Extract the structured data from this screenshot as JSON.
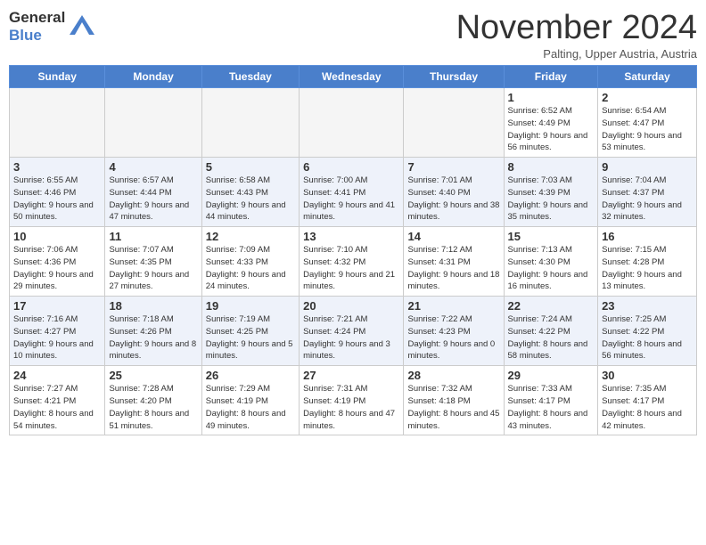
{
  "header": {
    "logo_text1": "General",
    "logo_text2": "Blue",
    "month_title": "November 2024",
    "location": "Palting, Upper Austria, Austria"
  },
  "days_of_week": [
    "Sunday",
    "Monday",
    "Tuesday",
    "Wednesday",
    "Thursday",
    "Friday",
    "Saturday"
  ],
  "weeks": [
    [
      {
        "day": "",
        "empty": true
      },
      {
        "day": "",
        "empty": true
      },
      {
        "day": "",
        "empty": true
      },
      {
        "day": "",
        "empty": true
      },
      {
        "day": "",
        "empty": true
      },
      {
        "day": "1",
        "sunrise": "6:52 AM",
        "sunset": "4:49 PM",
        "daylight": "9 hours and 56 minutes."
      },
      {
        "day": "2",
        "sunrise": "6:54 AM",
        "sunset": "4:47 PM",
        "daylight": "9 hours and 53 minutes."
      }
    ],
    [
      {
        "day": "3",
        "sunrise": "6:55 AM",
        "sunset": "4:46 PM",
        "daylight": "9 hours and 50 minutes."
      },
      {
        "day": "4",
        "sunrise": "6:57 AM",
        "sunset": "4:44 PM",
        "daylight": "9 hours and 47 minutes."
      },
      {
        "day": "5",
        "sunrise": "6:58 AM",
        "sunset": "4:43 PM",
        "daylight": "9 hours and 44 minutes."
      },
      {
        "day": "6",
        "sunrise": "7:00 AM",
        "sunset": "4:41 PM",
        "daylight": "9 hours and 41 minutes."
      },
      {
        "day": "7",
        "sunrise": "7:01 AM",
        "sunset": "4:40 PM",
        "daylight": "9 hours and 38 minutes."
      },
      {
        "day": "8",
        "sunrise": "7:03 AM",
        "sunset": "4:39 PM",
        "daylight": "9 hours and 35 minutes."
      },
      {
        "day": "9",
        "sunrise": "7:04 AM",
        "sunset": "4:37 PM",
        "daylight": "9 hours and 32 minutes."
      }
    ],
    [
      {
        "day": "10",
        "sunrise": "7:06 AM",
        "sunset": "4:36 PM",
        "daylight": "9 hours and 29 minutes."
      },
      {
        "day": "11",
        "sunrise": "7:07 AM",
        "sunset": "4:35 PM",
        "daylight": "9 hours and 27 minutes."
      },
      {
        "day": "12",
        "sunrise": "7:09 AM",
        "sunset": "4:33 PM",
        "daylight": "9 hours and 24 minutes."
      },
      {
        "day": "13",
        "sunrise": "7:10 AM",
        "sunset": "4:32 PM",
        "daylight": "9 hours and 21 minutes."
      },
      {
        "day": "14",
        "sunrise": "7:12 AM",
        "sunset": "4:31 PM",
        "daylight": "9 hours and 18 minutes."
      },
      {
        "day": "15",
        "sunrise": "7:13 AM",
        "sunset": "4:30 PM",
        "daylight": "9 hours and 16 minutes."
      },
      {
        "day": "16",
        "sunrise": "7:15 AM",
        "sunset": "4:28 PM",
        "daylight": "9 hours and 13 minutes."
      }
    ],
    [
      {
        "day": "17",
        "sunrise": "7:16 AM",
        "sunset": "4:27 PM",
        "daylight": "9 hours and 10 minutes."
      },
      {
        "day": "18",
        "sunrise": "7:18 AM",
        "sunset": "4:26 PM",
        "daylight": "9 hours and 8 minutes."
      },
      {
        "day": "19",
        "sunrise": "7:19 AM",
        "sunset": "4:25 PM",
        "daylight": "9 hours and 5 minutes."
      },
      {
        "day": "20",
        "sunrise": "7:21 AM",
        "sunset": "4:24 PM",
        "daylight": "9 hours and 3 minutes."
      },
      {
        "day": "21",
        "sunrise": "7:22 AM",
        "sunset": "4:23 PM",
        "daylight": "9 hours and 0 minutes."
      },
      {
        "day": "22",
        "sunrise": "7:24 AM",
        "sunset": "4:22 PM",
        "daylight": "8 hours and 58 minutes."
      },
      {
        "day": "23",
        "sunrise": "7:25 AM",
        "sunset": "4:22 PM",
        "daylight": "8 hours and 56 minutes."
      }
    ],
    [
      {
        "day": "24",
        "sunrise": "7:27 AM",
        "sunset": "4:21 PM",
        "daylight": "8 hours and 54 minutes."
      },
      {
        "day": "25",
        "sunrise": "7:28 AM",
        "sunset": "4:20 PM",
        "daylight": "8 hours and 51 minutes."
      },
      {
        "day": "26",
        "sunrise": "7:29 AM",
        "sunset": "4:19 PM",
        "daylight": "8 hours and 49 minutes."
      },
      {
        "day": "27",
        "sunrise": "7:31 AM",
        "sunset": "4:19 PM",
        "daylight": "8 hours and 47 minutes."
      },
      {
        "day": "28",
        "sunrise": "7:32 AM",
        "sunset": "4:18 PM",
        "daylight": "8 hours and 45 minutes."
      },
      {
        "day": "29",
        "sunrise": "7:33 AM",
        "sunset": "4:17 PM",
        "daylight": "8 hours and 43 minutes."
      },
      {
        "day": "30",
        "sunrise": "7:35 AM",
        "sunset": "4:17 PM",
        "daylight": "8 hours and 42 minutes."
      }
    ]
  ]
}
